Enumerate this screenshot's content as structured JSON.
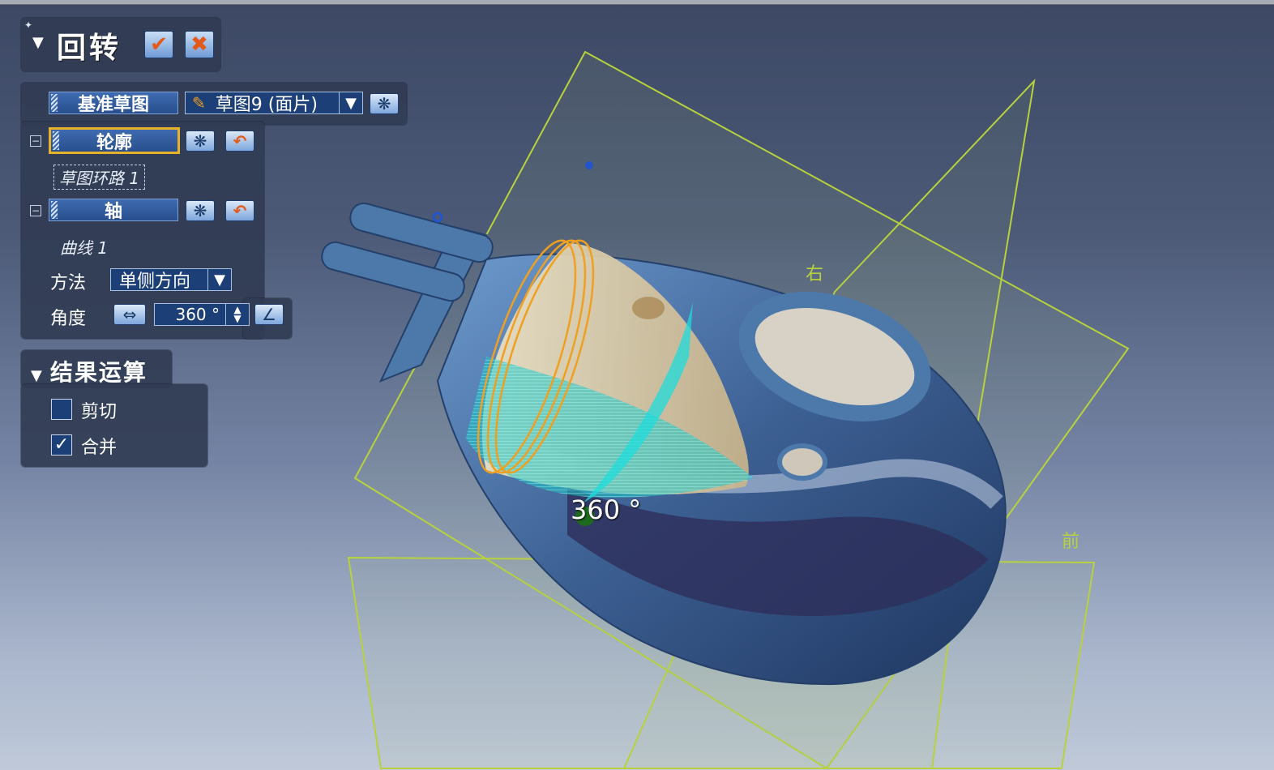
{
  "feature_panel": {
    "title": "回转",
    "ok_icon": "check-icon",
    "cancel_icon": "close-icon"
  },
  "params": {
    "base_sketch_label": "基准草图",
    "base_sketch_value": "草图9 (面片)",
    "profile_label": "轮廓",
    "profile_item": "草图环路 1",
    "axis_label": "轴",
    "axis_item": "曲线 1",
    "method_label": "方法",
    "method_value": "单侧方向",
    "angle_label": "角度",
    "angle_value": "360 °"
  },
  "result": {
    "title": "结果运算",
    "cut_label": "剪切",
    "cut_checked": false,
    "merge_label": "合并",
    "merge_checked": true
  },
  "viewport": {
    "plane_right_label": "右",
    "plane_front_label": "前",
    "angle_readout": "360 °"
  },
  "colors": {
    "panel_bg": "#313c54",
    "field_blue": "#284f8e",
    "active_border": "#e7b22a",
    "plane_line": "#b7d23c",
    "model_blue": "#4c78aa",
    "sweep_cyan": "#1fc8c8",
    "profile_orange": "#f0a020"
  }
}
